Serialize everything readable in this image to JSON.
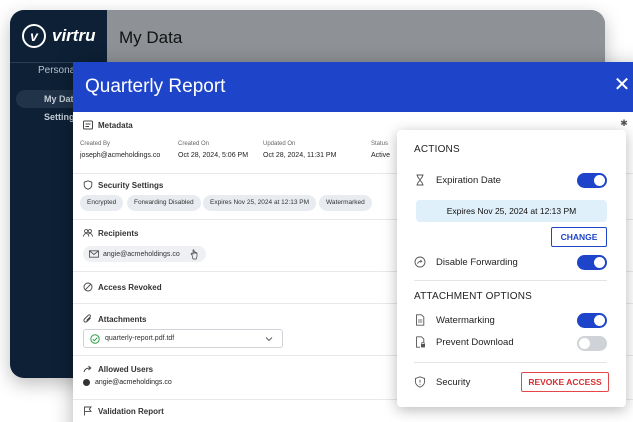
{
  "background_app": {
    "logo_text": "virtru",
    "sidebar_tab": "Persona",
    "sidebar_items": [
      "My Data",
      "Settings"
    ],
    "page_title": "My Data"
  },
  "modal": {
    "title": "Quarterly Report",
    "close_glyph": "✕",
    "settings_glyph": "✱",
    "metadata": {
      "heading": "Metadata",
      "columns": [
        {
          "label": "Created By",
          "value": "joseph@acmeholdings.co"
        },
        {
          "label": "Created On",
          "value": "Oct 28, 2024, 5:06 PM"
        },
        {
          "label": "Updated On",
          "value": "Oct 28, 2024, 11:31 PM"
        },
        {
          "label": "Status",
          "value": "Active"
        }
      ]
    },
    "security_settings": {
      "heading": "Security Settings",
      "chips": [
        "Encrypted",
        "Forwarding Disabled",
        "Expires Nov 25, 2024 at 12:13 PM",
        "Watermarked"
      ]
    },
    "recipients": {
      "heading": "Recipients",
      "items": [
        "angie@acmeholdings.co"
      ]
    },
    "access_revoked": {
      "heading": "Access Revoked"
    },
    "attachments": {
      "heading": "Attachments",
      "selected_file": "quarterly-report.pdf.tdf"
    },
    "allowed_users": {
      "heading": "Allowed Users",
      "items": [
        "angie@acmeholdings.co"
      ]
    },
    "validation_report": {
      "heading": "Validation Report"
    }
  },
  "popover": {
    "actions_heading": "ACTIONS",
    "expiration_label": "Expiration Date",
    "expiration_enabled": true,
    "expiry_text": "Expires Nov 25, 2024 at 12:13 PM",
    "change_label": "CHANGE",
    "disable_forwarding_label": "Disable Forwarding",
    "disable_forwarding_enabled": true,
    "attachment_options_heading": "ATTACHMENT OPTIONS",
    "watermarking_label": "Watermarking",
    "watermarking_enabled": true,
    "prevent_download_label": "Prevent Download",
    "prevent_download_enabled": false,
    "security_label": "Security",
    "revoke_label": "REVOKE ACCESS"
  },
  "colors": {
    "brand_blue": "#1e45c9",
    "sidebar_navy": "#0d2035",
    "revoke_red": "#d62f32",
    "expiry_bg": "#dff0fb"
  }
}
